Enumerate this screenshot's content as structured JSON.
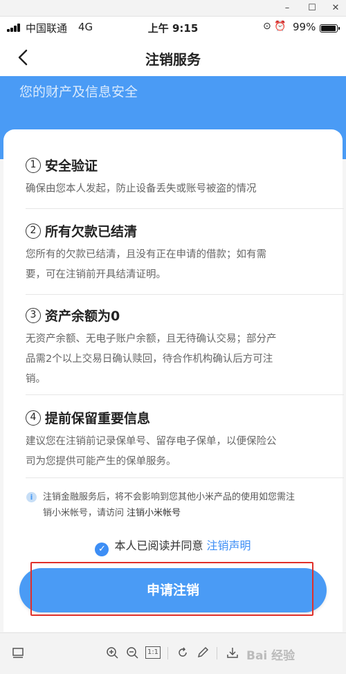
{
  "status_bar": {
    "carrier": "中国联通",
    "network": "4G",
    "time": "上午 9:15",
    "icons": [
      "orientation-lock-icon",
      "alarm-icon"
    ],
    "battery_percent": "99%",
    "battery_level": 0.99
  },
  "nav": {
    "title": "注销服务",
    "back_icon": "chevron-left-icon"
  },
  "banner": {
    "text": "您的财产及信息安全",
    "color": "#4a9bf5"
  },
  "items": [
    {
      "number": "1",
      "title": "安全验证",
      "desc": [
        "确保由您本人发起，防止设备丢失或账号被盗的情况"
      ]
    },
    {
      "number": "2",
      "title": "所有欠款已结清",
      "desc": [
        "您所有的欠款已结清，且没有正在申请的借款；如有需",
        "要，可在注销前开具结清证明。"
      ]
    },
    {
      "number": "3",
      "title": "资产余额为0",
      "desc": [
        "无资产余额、无电子账户余额，且无待确认交易；部分产",
        "品需2个以上交易日确认赎回，待合作机构确认后方可注",
        "销。"
      ]
    },
    {
      "number": "4",
      "title": "提前保留重要信息",
      "desc": [
        "建议您在注销前记录保单号、留存电子保单，以便保险公",
        "司为您提供可能产生的保单服务。"
      ]
    }
  ],
  "notice": {
    "icon": "info-icon",
    "line1": "注销金融服务后，将不会影响到您其他小米产品的使用如您需注",
    "line2_prefix": "销小米帐号，请访问 ",
    "link": "注销小米帐号"
  },
  "agreement": {
    "checked": true,
    "text": "本人已阅读并同意 ",
    "link": "注销声明"
  },
  "apply_button": {
    "label": "申请注销",
    "color": "#4a9bf5"
  },
  "highlight_color": "#e0302a",
  "toolbar": {
    "icons": [
      "screen-icon",
      "zoom-in-icon",
      "zoom-out-icon",
      "actual-size-icon",
      "rotate-icon",
      "edit-icon",
      "download-icon"
    ],
    "actual_size_label": "1:1",
    "watermark": "Bai 经验"
  },
  "window": {
    "minimize": "–",
    "maximize": "☐",
    "close": "✕"
  }
}
